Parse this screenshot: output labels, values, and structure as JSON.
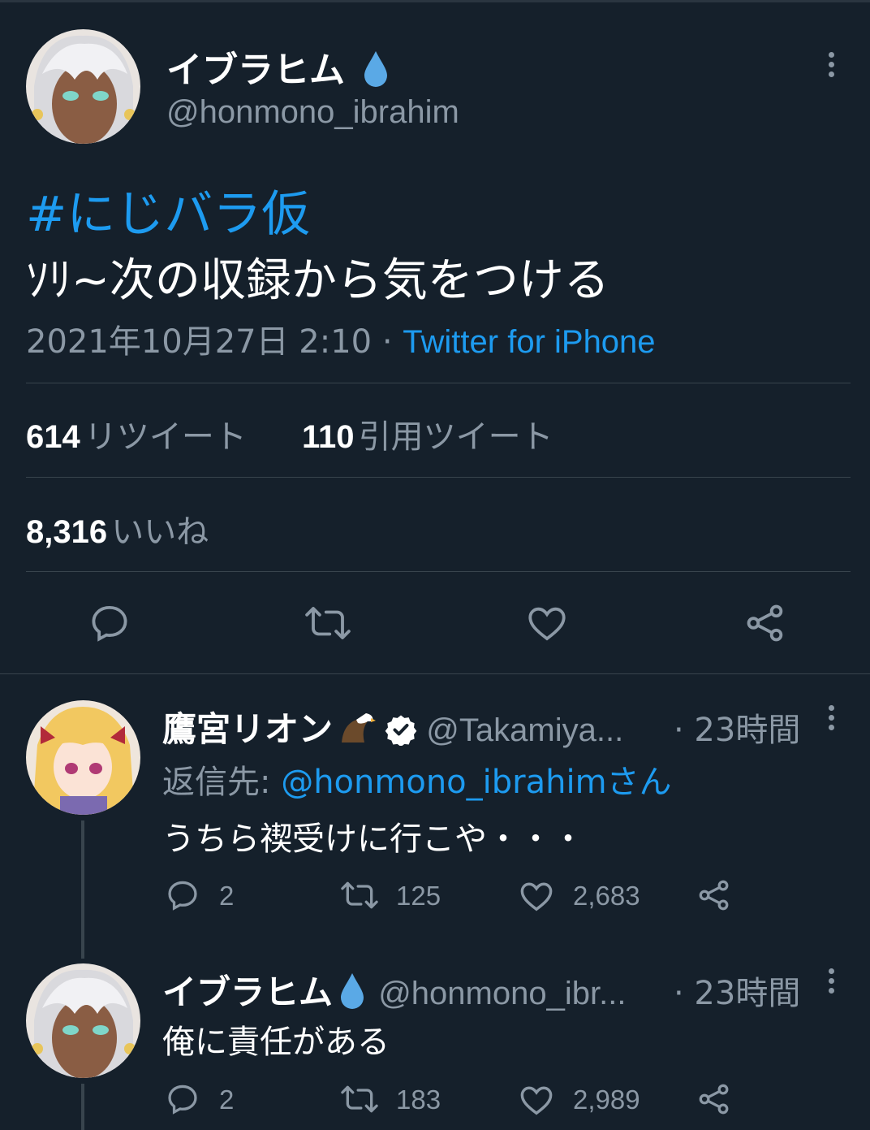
{
  "main_tweet": {
    "display_name": "イブラヒム",
    "handle": "@honmono_ibrahim",
    "hashtag": "#にじバラ仮",
    "text": "ｿﾘ~次の収録から気をつける",
    "timestamp": "2021年10月27日 2:10",
    "separator": "·",
    "source": "Twitter for iPhone",
    "retweets_count": "614",
    "retweets_label": "リツイート",
    "quotes_count": "110",
    "quotes_label": "引用ツイート",
    "likes_count": "8,316",
    "likes_label": "いいね"
  },
  "replies": [
    {
      "display_name": "鷹宮リオン",
      "handle": "@Takamiya...",
      "time": "· 23時間",
      "reply_to_label": "返信先:",
      "reply_to_handle": "@honmono_ibrahimさん",
      "text": "うちら禊受けに行こや・・・",
      "reply_count": "2",
      "retweet_count": "125",
      "like_count": "2,683"
    },
    {
      "display_name": "イブラヒム",
      "handle": "@honmono_ibr...",
      "time": "· 23時間",
      "text": "俺に責任がある",
      "reply_count": "2",
      "retweet_count": "183",
      "like_count": "2,989"
    }
  ],
  "colors": {
    "background": "#15202b",
    "accent": "#1d9bf0",
    "muted": "#8b98a5",
    "divider": "#38444d"
  }
}
